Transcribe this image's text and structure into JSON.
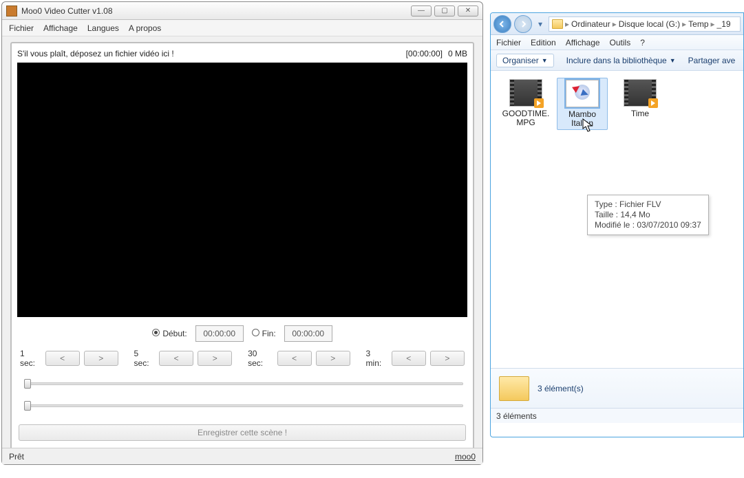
{
  "moo": {
    "title": "Moo0 Video Cutter v1.08",
    "menu": {
      "file": "Fichier",
      "view": "Affichage",
      "lang": "Langues",
      "about": "A propos"
    },
    "prompt": "S'il vous plaît, déposez un fichier vidéo ici !",
    "timecode": "[00:00:00]",
    "size": "0 MB",
    "start_label": "Début:",
    "start_value": "00:00:00",
    "end_label": "Fin:",
    "end_value": "00:00:00",
    "seek": {
      "s1": "1 sec:",
      "s5": "5 sec:",
      "s30": "30 sec:",
      "m3": "3 min:",
      "back": "<",
      "fwd": ">"
    },
    "save": "Enregistrer cette scène !",
    "status_ready": "Prêt",
    "status_link": "moo0"
  },
  "explorer": {
    "breadcrumb": {
      "b1": "Ordinateur",
      "b2": "Disque local (G:)",
      "b3": "Temp",
      "b4": "_19"
    },
    "menu": {
      "file": "Fichier",
      "edit": "Edition",
      "view": "Affichage",
      "tools": "Outils",
      "help": "?"
    },
    "toolbar": {
      "organize": "Organiser",
      "include": "Inclure dans la bibliothèque",
      "share": "Partager ave"
    },
    "files": {
      "f1": "GOODTIME.MPG",
      "f2a": "Mambo",
      "f2b": "Italian",
      "f3": "Time"
    },
    "tooltip": {
      "l1": "Type : Fichier FLV",
      "l2": "Taille : 14,4 Mo",
      "l3": "Modifié le : 03/07/2010 09:37"
    },
    "details": "3 élément(s)",
    "status": "3 éléments"
  }
}
